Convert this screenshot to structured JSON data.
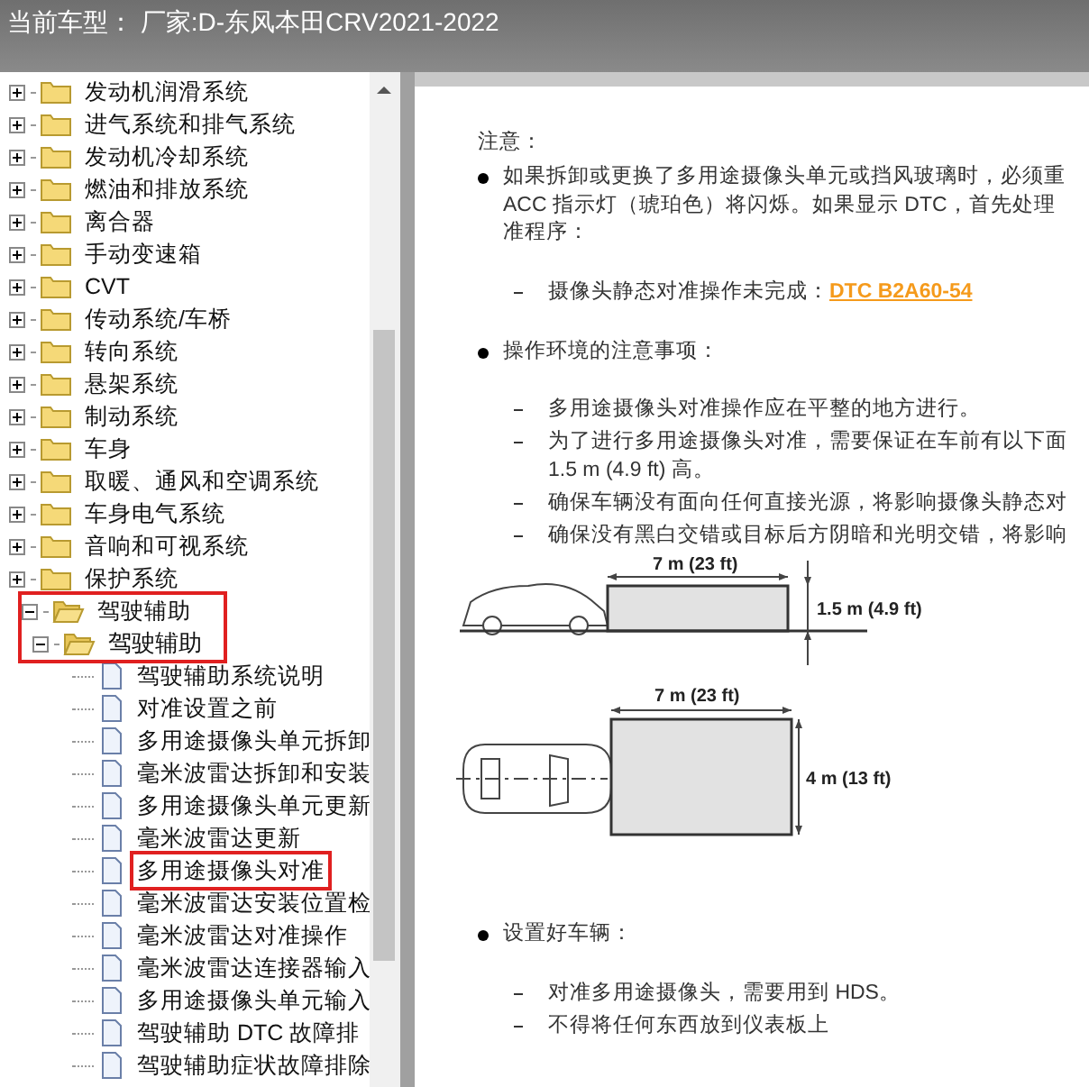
{
  "title_bar": {
    "text": "当前车型：  厂家:D-东风本田CRV2021-2022"
  },
  "tree": [
    {
      "label": "发动机润滑系统",
      "expanded": false
    },
    {
      "label": "进气系统和排气系统",
      "expanded": false
    },
    {
      "label": "发动机冷却系统",
      "expanded": false
    },
    {
      "label": "燃油和排放系统",
      "expanded": false
    },
    {
      "label": "离合器",
      "expanded": false
    },
    {
      "label": "手动变速箱",
      "expanded": false
    },
    {
      "label": "CVT",
      "expanded": false
    },
    {
      "label": "传动系统/车桥",
      "expanded": false
    },
    {
      "label": "转向系统",
      "expanded": false
    },
    {
      "label": "悬架系统",
      "expanded": false
    },
    {
      "label": "制动系统",
      "expanded": false
    },
    {
      "label": "车身",
      "expanded": false
    },
    {
      "label": "取暖、通风和空调系统",
      "expanded": false
    },
    {
      "label": "车身电气系统",
      "expanded": false
    },
    {
      "label": "音响和可视系统",
      "expanded": false
    },
    {
      "label": "保护系统",
      "expanded": false
    },
    {
      "label": "驾驶辅助",
      "expanded": true,
      "highlighted": true,
      "children": [
        {
          "label": "驾驶辅助",
          "expanded": true,
          "highlighted": true,
          "children": [
            {
              "label": "驾驶辅助系统说明",
              "highlighted": false
            },
            {
              "label": "对准设置之前",
              "highlighted": false
            },
            {
              "label": "多用途摄像头单元拆卸",
              "highlighted": false
            },
            {
              "label": "毫米波雷达拆卸和安装",
              "highlighted": false
            },
            {
              "label": "多用途摄像头单元更新",
              "highlighted": false
            },
            {
              "label": "毫米波雷达更新",
              "highlighted": false
            },
            {
              "label": "多用途摄像头对准",
              "highlighted": true
            },
            {
              "label": "毫米波雷达安装位置检",
              "highlighted": false
            },
            {
              "label": "毫米波雷达对准操作",
              "highlighted": false
            },
            {
              "label": "毫米波雷达连接器输入",
              "highlighted": false
            },
            {
              "label": "多用途摄像头单元输入",
              "highlighted": false
            },
            {
              "label": "驾驶辅助 DTC 故障排",
              "highlighted": false
            },
            {
              "label": "驾驶辅助症状故障排除",
              "highlighted": false
            }
          ]
        }
      ]
    }
  ],
  "document": {
    "heading": "注意：",
    "bullets": [
      {
        "lines": [
          "如果拆卸或更换了多用途摄像头单元或挡风玻璃时，必须重",
          "ACC 指示灯（琥珀色）将闪烁。如果显示 DTC，首先处理",
          "准程序："
        ],
        "items": [
          {
            "text": "摄像头静态对准操作未完成：",
            "link": "DTC B2A60-54"
          }
        ]
      },
      {
        "lines": [
          "操作环境的注意事项："
        ],
        "items": [
          {
            "text": "多用途摄像头对准操作应在平整的地方进行。"
          },
          {
            "text": "为了进行多用途摄像头对准，需要保证在车前有以下面",
            "continuation": "1.5 m (4.9 ft) 高。"
          },
          {
            "text": "确保车辆没有面向任何直接光源，将影响摄像头静态对"
          },
          {
            "text": "确保没有黑白交错或目标后方阴暗和光明交错，将影响"
          }
        ],
        "diagram": {
          "side_length": "7 m (23 ft)",
          "side_height": "1.5 m (4.9 ft)",
          "top_length": "7 m (23 ft)",
          "top_width": "4 m (13 ft)"
        }
      },
      {
        "lines": [
          "设置好车辆："
        ],
        "items": [
          {
            "text": "对准多用途摄像头，需要用到 HDS。"
          },
          {
            "text": "不得将任何东西放到仪表板上"
          }
        ]
      }
    ]
  }
}
